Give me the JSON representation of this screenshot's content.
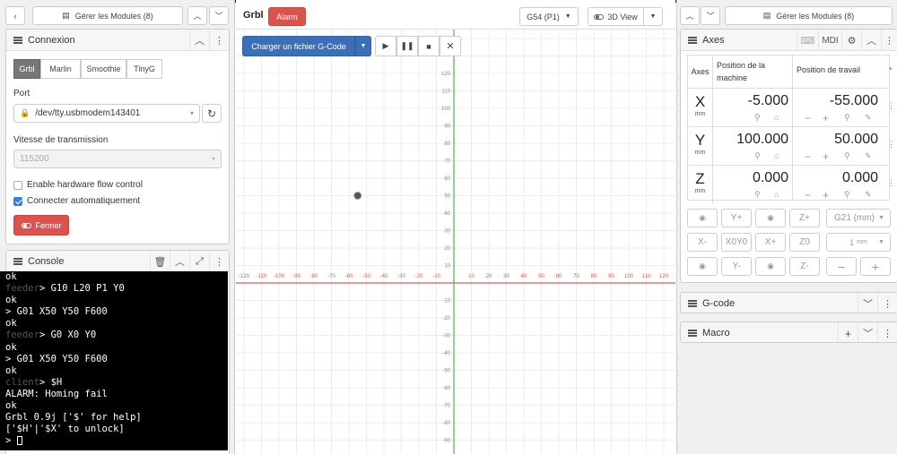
{
  "left_top": {
    "manage_modules": "Gérer les Modules (8)"
  },
  "connection": {
    "title": "Connexion",
    "tabs": [
      "Grbl",
      "Marlin",
      "Smoothie",
      "TinyG"
    ],
    "active_tab": "Grbl",
    "port_label": "Port",
    "port_value": "/dev/tty.usbmodem143401",
    "baud_label": "Vitesse de transmission",
    "baud_value": "115200",
    "hw_flow_label": "Enable hardware flow control",
    "hw_flow_checked": false,
    "auto_connect_label": "Connecter automatiquement",
    "auto_connect_checked": true,
    "close_button": "Fermer"
  },
  "console": {
    "title": "Console",
    "lines": [
      {
        "prompt": "",
        "text": "ok"
      },
      {
        "prompt": "feeder",
        "text": "> G10 L20 P1 Y0"
      },
      {
        "prompt": "",
        "text": "ok"
      },
      {
        "prompt": "",
        "text": "> G01 X50 Y50 F600"
      },
      {
        "prompt": "",
        "text": "ok"
      },
      {
        "prompt": "feeder",
        "text": "> G0 X0 Y0"
      },
      {
        "prompt": "",
        "text": "ok"
      },
      {
        "prompt": "",
        "text": "> G01 X50 Y50 F600"
      },
      {
        "prompt": "",
        "text": "ok"
      },
      {
        "prompt": "client",
        "text": "> $H"
      },
      {
        "prompt": "",
        "text": "ALARM: Homing fail"
      },
      {
        "prompt": "",
        "text": "ok"
      },
      {
        "prompt": "",
        "text": "Grbl 0.9j ['$' for help]"
      },
      {
        "prompt": "",
        "text": "['$H'|'$X' to unlock]"
      },
      {
        "prompt": "",
        "text": "> "
      }
    ]
  },
  "middle": {
    "title": "Grbl",
    "alarm_badge": "Alarm",
    "coord_system": "G54 (P1)",
    "view_mode": "3D View",
    "load_gcode": "Charger un fichier G-Code",
    "x_ticks": [
      "-120",
      "-110",
      "-100",
      "-90",
      "-80",
      "-70",
      "-60",
      "-50",
      "-40",
      "-30",
      "-20",
      "-10",
      "10",
      "20",
      "30",
      "40",
      "50",
      "60",
      "70",
      "80",
      "90",
      "100",
      "110",
      "120"
    ],
    "y_ticks": [
      "120",
      "110",
      "100",
      "90",
      "80",
      "70",
      "60",
      "50",
      "40",
      "30",
      "20",
      "10",
      "-10",
      "-20",
      "-30",
      "-40",
      "-50",
      "-60",
      "-70",
      "-80",
      "-90"
    ],
    "colors": {
      "x_axis": "#e05555",
      "y_axis": "#55b055",
      "primary": "#3b6fb6",
      "alarm": "#d9534f"
    }
  },
  "right_top": {
    "manage_modules": "Gérer les Modules (8)"
  },
  "axes": {
    "title": "Axes",
    "mdi_label": "MDI",
    "col_axes": "Axes",
    "col_machine": "Position de la machine",
    "col_work": "Position de travail",
    "unit": "mm",
    "rows": [
      {
        "axis": "X",
        "machine": "-5.000",
        "work": "-55.000"
      },
      {
        "axis": "Y",
        "machine": "100.000",
        "work": "50.000"
      },
      {
        "axis": "Z",
        "machine": "0.000",
        "work": "0.000"
      }
    ],
    "jog": {
      "row1": [
        "Y+",
        "Z+"
      ],
      "row2": [
        "X-",
        "X0Y0",
        "X+",
        "Z0"
      ],
      "row3": [
        "Y-",
        "Z-"
      ],
      "units": "G21 (mm)",
      "step": "1",
      "step_unit": "mm"
    }
  },
  "gcode_panel": {
    "title": "G-code"
  },
  "macro_panel": {
    "title": "Macro"
  }
}
